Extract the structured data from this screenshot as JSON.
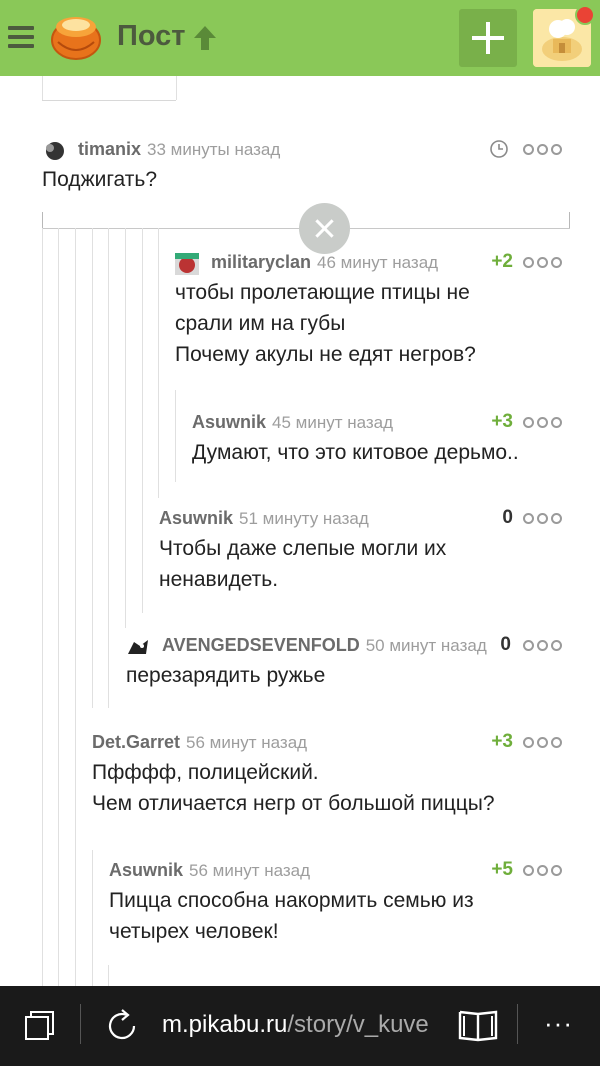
{
  "header": {
    "title": "Пост",
    "colors": {
      "bar": "#8ac858",
      "title": "#4c5a3e",
      "add_button": "#79b04a",
      "notification": "#ea4335"
    },
    "icons": [
      "menu-icon",
      "pikabu-logo",
      "up-arrow-icon",
      "plus-icon",
      "user-avatar"
    ]
  },
  "comments": [
    {
      "author": "timanix",
      "time": "33 минуты назад",
      "text": "Поджигать?",
      "rating": ""
    },
    {
      "author": "militaryclan",
      "time": "46 минут назад",
      "text": [
        "чтобы пролетающие птицы не",
        "срали им на губы",
        "Почему акулы не едят негров?"
      ],
      "rating": "+2"
    },
    {
      "author": "Asuwnik",
      "time": "45 минут назад",
      "text": "Думают, что это китовое дерьмо..",
      "rating": "+3"
    },
    {
      "author": "Asuwnik",
      "time": "51 минуту назад",
      "text": [
        "Чтобы даже слепые могли их",
        "ненавидеть."
      ],
      "rating": "0"
    },
    {
      "author": "AVENGEDSEVENFOLD",
      "time": "50 минут назад",
      "text": "перезарядить ружье",
      "rating": "0"
    },
    {
      "author": "Det.Garret",
      "time": "56 минут назад",
      "text": [
        "Пфффф, полицейский.",
        "Чем отличается негр от большой пиццы?"
      ],
      "rating": "+3"
    },
    {
      "author": "Asuwnik",
      "time": "56 минут назад",
      "text": [
        "Пицца способна накормить семью из",
        "четырех человек!"
      ],
      "rating": "+5"
    }
  ],
  "browser": {
    "url_host": "m.pikabu.ru",
    "url_path": "/story/v_kuve",
    "icons": [
      "tabs-icon",
      "refresh-icon",
      "reading-view-icon",
      "more-icon"
    ],
    "more_label": "···"
  }
}
